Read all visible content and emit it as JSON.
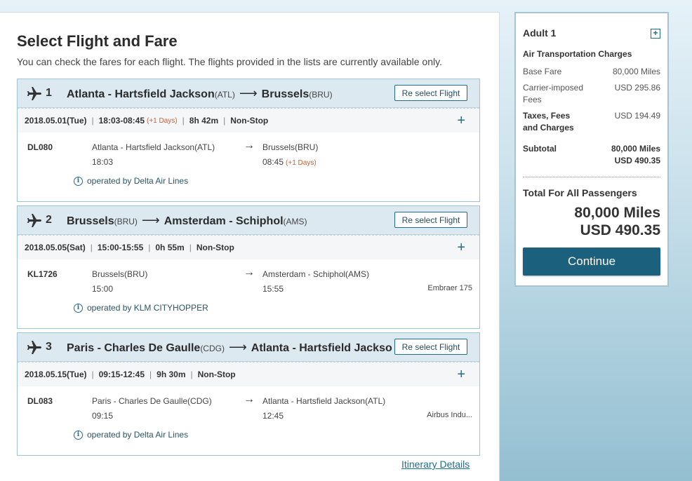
{
  "page": {
    "title": "Select Flight and Fare",
    "subtitle": "You can check the fares for each flight. The flights provided in the lists are currently available only."
  },
  "flights": [
    {
      "number": "1",
      "origin": "Atlanta - Hartsfield Jackson",
      "origin_code": "(ATL)",
      "destination": "Brussels",
      "destination_code": "(BRU)",
      "reselect_label": "Re select Flight",
      "date": "2018.05.01(Tue)",
      "times": "18:03-08:45",
      "plus_days": "(+1 Days)",
      "duration": "8h 42m",
      "stops": "Non-Stop",
      "flight_no": "DL080",
      "dep_name": "Atlanta - Hartsfield Jackson(ATL)",
      "dep_time": "18:03",
      "arr_name": "Brussels(BRU)",
      "arr_time": "08:45",
      "arr_plus_days": "(+1 Days)",
      "aircraft": "",
      "operated_by": "operated by Delta Air Lines"
    },
    {
      "number": "2",
      "origin": "Brussels",
      "origin_code": "(BRU)",
      "destination": "Amsterdam - Schiphol",
      "destination_code": "(AMS)",
      "reselect_label": "Re select Flight",
      "date": "2018.05.05(Sat)",
      "times": "15:00-15:55",
      "plus_days": "",
      "duration": "0h 55m",
      "stops": "Non-Stop",
      "flight_no": "KL1726",
      "dep_name": "Brussels(BRU)",
      "dep_time": "15:00",
      "arr_name": "Amsterdam - Schiphol(AMS)",
      "arr_time": "15:55",
      "arr_plus_days": "",
      "aircraft": "Embraer 175",
      "operated_by": "operated by KLM CITYHOPPER"
    },
    {
      "number": "3",
      "origin": "Paris - Charles De Gaulle",
      "origin_code": "(CDG)",
      "destination": "Atlanta - Hartsfield Jackso",
      "destination_code": "",
      "reselect_label": "Re select Flight",
      "date": "2018.05.15(Tue)",
      "times": "09:15-12:45",
      "plus_days": "",
      "duration": "9h 30m",
      "stops": "Non-Stop",
      "flight_no": "DL083",
      "dep_name": "Paris - Charles De Gaulle(CDG)",
      "dep_time": "09:15",
      "arr_name": "Atlanta - Hartsfield Jackson(ATL)",
      "arr_time": "12:45",
      "arr_plus_days": "",
      "aircraft": "Airbus Indu...",
      "operated_by": "operated by Delta Air Lines"
    }
  ],
  "itinerary_link": "Itinerary Details",
  "fare": {
    "passenger": "Adult 1",
    "section": "Air Transportation Charges",
    "base_fare_label": "Base Fare",
    "base_fare_value": "80,000 Miles",
    "carrier_label": "Carrier-imposed Fees",
    "carrier_value": "USD 295.86",
    "taxes_label": "Taxes, Fees and Charges",
    "taxes_value": "USD 194.49",
    "subtotal_label": "Subtotal",
    "subtotal_miles": "80,000 Miles",
    "subtotal_usd": "USD 490.35",
    "total_label": "Total For All Passengers",
    "total_miles": "80,000 Miles",
    "total_usd": "USD 490.35",
    "continue_label": "Continue"
  },
  "colors": {
    "accent": "#1b607c",
    "header_bg": "#dde9f0",
    "plus_days": "#c9603a"
  }
}
